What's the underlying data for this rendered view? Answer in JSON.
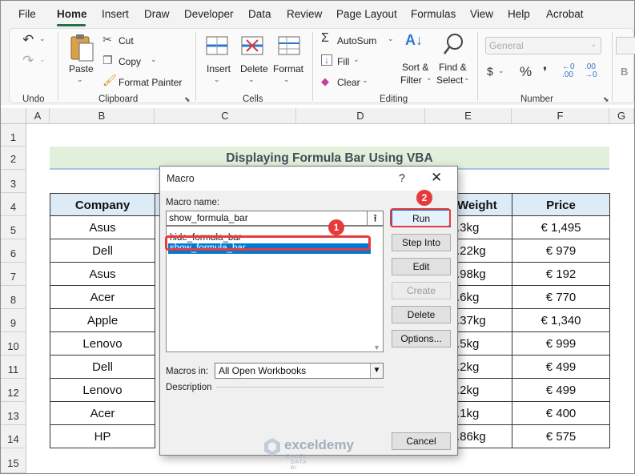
{
  "menu": {
    "tabs": [
      "File",
      "Home",
      "Insert",
      "Draw",
      "Developer",
      "Data",
      "Review",
      "Page Layout",
      "Formulas",
      "View",
      "Help",
      "Acrobat"
    ],
    "active": "Home"
  },
  "ribbon": {
    "undo_label": "Undo",
    "clipboard": {
      "paste": "Paste",
      "cut": "Cut",
      "copy": "Copy",
      "format_painter": "Format Painter",
      "label": "Clipboard"
    },
    "cells": {
      "insert": "Insert",
      "delete": "Delete",
      "format": "Format",
      "label": "Cells"
    },
    "editing": {
      "autosum": "AutoSum",
      "fill": "Fill",
      "clear": "Clear",
      "sort_filter_1": "Sort &",
      "sort_filter_2": "Filter",
      "find_select_1": "Find &",
      "find_select_2": "Select",
      "label": "Editing"
    },
    "number": {
      "format_value": "General",
      "dollar": "$",
      "percent": "%",
      "comma": "❜",
      "label": "Number"
    },
    "partial_bold": "B"
  },
  "sheet": {
    "columns": [
      "A",
      "B",
      "C",
      "D",
      "E",
      "F",
      "G"
    ],
    "rows": [
      "1",
      "2",
      "3",
      "4",
      "5",
      "6",
      "7",
      "8",
      "9",
      "10",
      "11",
      "12",
      "13",
      "14",
      "15"
    ],
    "title": "Displaying Formula Bar Using VBA",
    "headers": {
      "company": "Company",
      "weight_partial": "Weight",
      "price": "Price"
    },
    "companies": [
      "Asus",
      "Dell",
      "Asus",
      "Acer",
      "Apple",
      "Lenovo",
      "Dell",
      "Lenovo",
      "Acer",
      "HP"
    ],
    "weights_partial": [
      ".3kg",
      ".22kg",
      ".98kg",
      ".6kg",
      ".37kg",
      ".5kg",
      ".2kg",
      ".2kg",
      ".1kg",
      ".86kg"
    ],
    "prices": [
      "€ 1,495",
      "€ 979",
      "€ 192",
      "€ 770",
      "€ 1,340",
      "€ 999",
      "€ 499",
      "€ 499",
      "€ 400",
      "€ 575"
    ]
  },
  "dialog": {
    "title": "Macro",
    "help": "?",
    "close": "✕",
    "macro_name_label": "Macro name:",
    "macro_name_value": "show_formula_bar",
    "list": [
      "hide_formula_bar",
      "show_formula_bar"
    ],
    "selected": "show_formula_bar",
    "macros_in_label": "Macros in:",
    "macros_in_value": "All Open Workbooks",
    "description_label": "Description",
    "buttons": {
      "run": "Run",
      "step_into": "Step Into",
      "edit": "Edit",
      "create": "Create",
      "delete": "Delete",
      "options": "Options...",
      "cancel": "Cancel"
    }
  },
  "annotations": {
    "step1": "1",
    "step2": "2"
  },
  "watermark": {
    "name": "exceldemy",
    "tagline": "EXCEL · DATA · BI"
  },
  "colors": {
    "accent_green": "#217346",
    "title_band": "#e2efda",
    "header_fill": "#ddebf7",
    "annotation_red": "#e53b3b",
    "selection_blue": "#0078d7"
  }
}
